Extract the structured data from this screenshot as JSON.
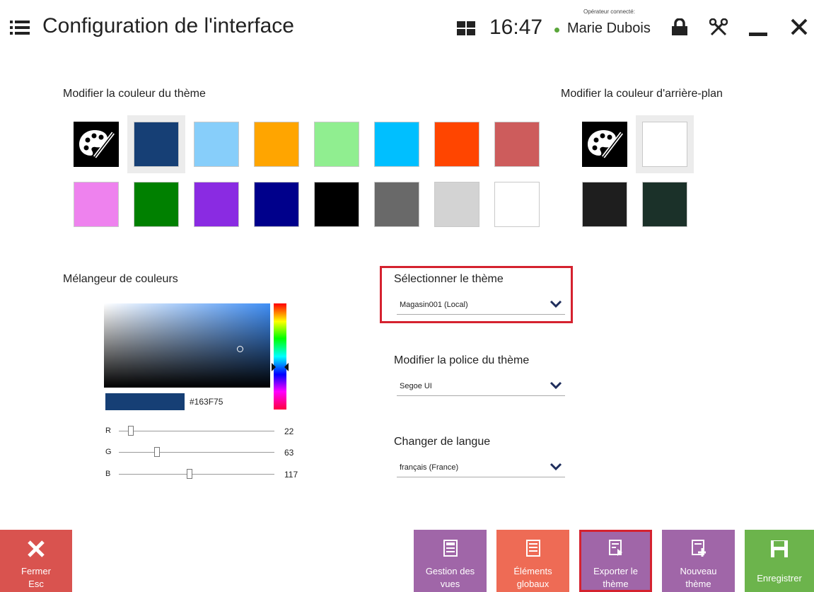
{
  "header": {
    "title": "Configuration de l'interface",
    "time": "16:47",
    "operator_caption": "Opérateur connecté:",
    "operator_name": "Marie Dubois",
    "status_color": "#5aa63a"
  },
  "theme_color": {
    "label": "Modifier la couleur du thème",
    "swatches": [
      "custom-palette",
      "#163F75",
      "#87CEFA",
      "#FFA500",
      "#90EE90",
      "#00BFFF",
      "#FF4500",
      "#CD5C5C",
      "#EE82EE",
      "#008000",
      "#8A2BE2",
      "#00008B",
      "#000000",
      "#696969",
      "#D3D3D3",
      "#FFFFFF"
    ],
    "selected_index": 1
  },
  "background_color": {
    "label": "Modifier la couleur d'arrière-plan",
    "swatches": [
      "custom-palette",
      "#FFFFFF",
      "#1E1E1E",
      "#1B3129"
    ],
    "selected_index": 1
  },
  "mixer": {
    "label": "Mélangeur de couleurs",
    "hex": "#163F75",
    "r_label": "R",
    "r_value": "22",
    "g_label": "G",
    "g_value": "63",
    "b_label": "B",
    "b_value": "117"
  },
  "theme_select": {
    "label": "Sélectionner le thème",
    "value": "Magasin001 (Local)"
  },
  "font_select": {
    "label": "Modifier la police du thème",
    "value": "Segoe UI"
  },
  "language_select": {
    "label": "Changer de langue",
    "value": "français (France)"
  },
  "footer": {
    "close_line1": "Fermer",
    "close_line2": "Esc",
    "views_line1": "Gestion des",
    "views_line2": "vues",
    "global_line1": "Éléments",
    "global_line2": "globaux",
    "export_line1": "Exporter le",
    "export_line2": "thème",
    "new_line1": "Nouveau",
    "new_line2": "thème",
    "save_label": "Enregistrer",
    "colors": {
      "close": "#d9534f",
      "views": "#a066a8",
      "global": "#ee6b55",
      "export": "#a066a8",
      "new": "#a066a8",
      "save": "#6cb44c"
    }
  }
}
